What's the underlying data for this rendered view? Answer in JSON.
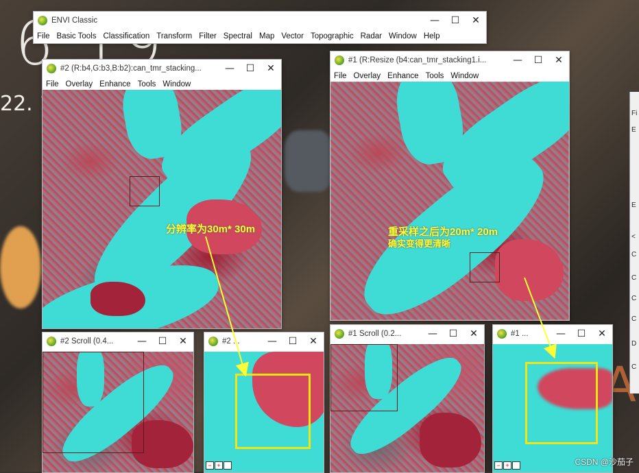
{
  "desktop": {
    "clock_time": "6 19",
    "clock_date": "22. 1",
    "deco_letter": "A"
  },
  "envi_main": {
    "title": "ENVI Classic",
    "menu": [
      "File",
      "Basic Tools",
      "Classification",
      "Transform",
      "Filter",
      "Spectral",
      "Map",
      "Vector",
      "Topographic",
      "Radar",
      "Window",
      "Help"
    ]
  },
  "win2_image": {
    "title": "#2 (R:b4,G:b3,B:b2):can_tmr_stacking...",
    "menu": [
      "File",
      "Overlay",
      "Enhance",
      "Tools",
      "Window"
    ],
    "annotation": "分辨率为30m* 30m"
  },
  "win1_image": {
    "title": "#1 (R:Resize (b4:can_tmr_stacking1.i...",
    "menu": [
      "File",
      "Overlay",
      "Enhance",
      "Tools",
      "Window"
    ],
    "annotation_line1": "重采样之后为20m* 20m",
    "annotation_line2": "确实变得更清晰"
  },
  "win2_scroll": {
    "title": "#2 Scroll (0.4..."
  },
  "win2_zoom": {
    "title": "#2 ..."
  },
  "win1_scroll": {
    "title": "#1 Scroll (0.2..."
  },
  "win1_zoom": {
    "title": "#1 ..."
  },
  "controls": {
    "minimize": "—",
    "maximize": "☐",
    "close": "✕"
  },
  "watermark": "CSDN @沙茄子",
  "side_letters": [
    "Fi",
    "E",
    "E",
    "<",
    "C",
    "C",
    "C",
    "C",
    "D",
    "C"
  ],
  "colors": {
    "water": "#3fdcd6",
    "vegetation": "#d0475e",
    "annotation": "#ffff33"
  }
}
